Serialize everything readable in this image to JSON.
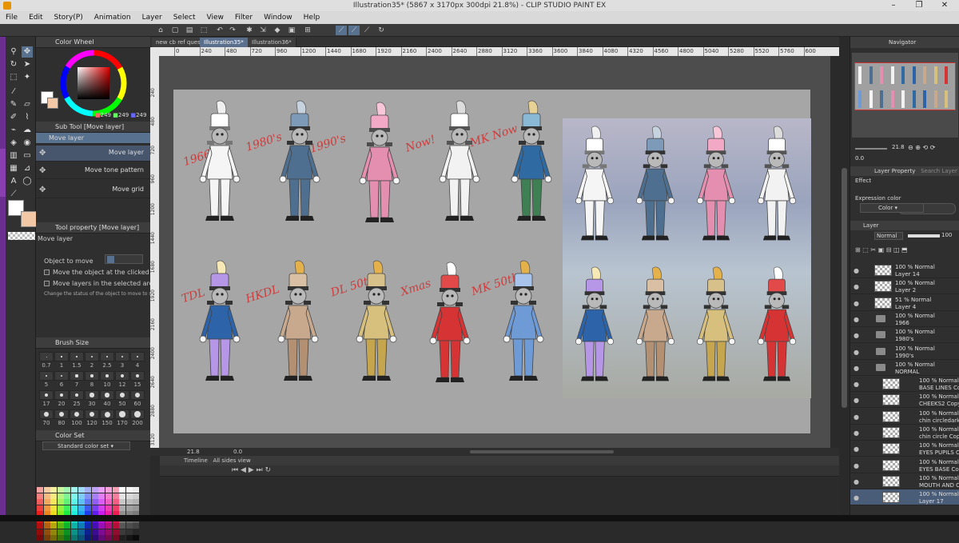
{
  "title_bar": {
    "text": "Illustration35* (5867 x 3170px 300dpi 21.8%) - CLIP STUDIO PAINT EX"
  },
  "menu": [
    "File",
    "Edit",
    "Story(P)",
    "Animation",
    "Layer",
    "Select",
    "View",
    "Filter",
    "Window",
    "Help"
  ],
  "window_controls": [
    "–",
    "❐",
    "✕"
  ],
  "left_panel": {
    "color_wheel_title": "Color Wheel",
    "color_values": {
      "r": "249",
      "g": "249",
      "b": "249"
    },
    "subtool_title": "Sub Tool [Move layer]",
    "subtool_group": "Move layer",
    "subtools": [
      "Move layer",
      "Move tone pattern",
      "Move grid"
    ],
    "tool_property_title": "Tool property [Move layer]",
    "tool_property_name": "Move layer",
    "object_to_move": "Object to move",
    "options": [
      "Move the object at the clicked position",
      "Move layers in the selected area",
      "Change the status of the object to move to selec"
    ],
    "brush_size_title": "Brush Size",
    "brush_sizes": [
      "0.7",
      "1",
      "1.5",
      "2",
      "2.5",
      "3",
      "4",
      "5",
      "6",
      "7",
      "8",
      "10",
      "12",
      "15",
      "17",
      "20",
      "25",
      "30",
      "40",
      "50",
      "60",
      "70",
      "80",
      "100",
      "120",
      "150",
      "170",
      "200"
    ],
    "color_set_title": "Color Set",
    "color_set_name": "Standard color set"
  },
  "tabs": [
    "new cb ref ques",
    "Illustration35*",
    "Illustration36*"
  ],
  "ruler_top_labels": [
    "0",
    "240",
    "480",
    "720",
    "960",
    "1200",
    "1440",
    "1680",
    "1920",
    "2160",
    "2400",
    "2640",
    "2880",
    "3120",
    "3360",
    "3600",
    "3840",
    "4080",
    "4320",
    "4560",
    "4800",
    "5040",
    "5280",
    "5520",
    "5760",
    "600"
  ],
  "ruler_left_labels": [
    "240",
    "480",
    "720",
    "960",
    "1200",
    "1440",
    "1680",
    "1920",
    "2160",
    "2400",
    "2640",
    "2880",
    "3120"
  ],
  "annotations": [
    "1966",
    "1980's",
    "1990's",
    "Now!",
    "MK Now",
    "TDL",
    "HKDL",
    "DL 50th",
    "Xmas",
    "MK 50th"
  ],
  "status": {
    "zoom": "21.8",
    "rotation": "0.0"
  },
  "timeline": {
    "title": "Timeline",
    "subtitle": "All sides view"
  },
  "navigator": {
    "title": "Navigator",
    "zoom": "21.8",
    "angle": "0.0"
  },
  "layer_property": {
    "title": "Layer Property",
    "search": "Search Layer",
    "effect": "Effect",
    "expression_color": "Expression color",
    "color_mode": "Color"
  },
  "layer_panel": {
    "title": "Layer",
    "blend_mode": "Normal",
    "opacity": "100",
    "layers": [
      {
        "pct": "100 % Normal",
        "name": "Layer 14",
        "kind": "layer"
      },
      {
        "pct": "100 % Normal",
        "name": "Layer 2",
        "kind": "layer"
      },
      {
        "pct": "51 % Normal",
        "name": "Layer 4",
        "kind": "layer"
      },
      {
        "pct": "100 % Normal",
        "name": "1966",
        "kind": "folder"
      },
      {
        "pct": "100 % Normal",
        "name": "1980's",
        "kind": "folder"
      },
      {
        "pct": "100 % Normal",
        "name": "1990's",
        "kind": "folder"
      },
      {
        "pct": "100 % Normal",
        "name": "NORMAL",
        "kind": "folder"
      },
      {
        "pct": "100 % Normal",
        "name": "BASE LINES Co",
        "kind": "layer"
      },
      {
        "pct": "100 % Normal",
        "name": "CHEEKS2 Copy 2",
        "kind": "layer"
      },
      {
        "pct": "100 % Normal",
        "name": "chin circledark C",
        "kind": "layer"
      },
      {
        "pct": "100 % Normal",
        "name": "chin circle Copy 2",
        "kind": "layer"
      },
      {
        "pct": "100 % Normal",
        "name": "EYES PUPILS C",
        "kind": "layer"
      },
      {
        "pct": "100 % Normal",
        "name": "EYES BASE Cop",
        "kind": "layer"
      },
      {
        "pct": "100 % Normal",
        "name": "MOUTH AND C",
        "kind": "layer"
      },
      {
        "pct": "100 % Normal",
        "name": "Layer 17",
        "kind": "layer"
      }
    ]
  },
  "colors": {
    "accent": "#57718f",
    "selected_layer": "#4a5d78",
    "artboard": "#a6a6a6",
    "annotation": "#cf3b3b"
  },
  "figures": [
    {
      "coat": "#f5f5f5",
      "pants": "#f5f5f5",
      "hat": "#ffffff",
      "plume": "#f0f0f0",
      "trim": "#777"
    },
    {
      "coat": "#4e6f8f",
      "pants": "#4e6f8f",
      "hat": "#7d9ab8",
      "plume": "#c7d2df",
      "trim": "#333"
    },
    {
      "coat": "#e58fb0",
      "pants": "#e58fb0",
      "hat": "#f2a9c5",
      "plume": "#f7c6d8",
      "trim": "#4d4d4d"
    },
    {
      "coat": "#f2f2f2",
      "pants": "#f2f2f2",
      "hat": "#ffffff",
      "plume": "#dcdcdc",
      "trim": "#555"
    },
    {
      "coat": "#2f6aa3",
      "pants": "#3f7f54",
      "hat": "#8ab9d6",
      "plume": "#e7d195",
      "trim": "#333"
    },
    {
      "coat": "#2d63a8",
      "pants": "#b696e6",
      "hat": "#b696e6",
      "plume": "#f6e9b5",
      "trim": "#333"
    },
    {
      "coat": "#c9a98d",
      "pants": "#b49072",
      "hat": "#d9c0a4",
      "plume": "#e5b14a",
      "trim": "#333"
    },
    {
      "coat": "#d7bf7d",
      "pants": "#c5a64f",
      "hat": "#d7c08a",
      "plume": "#e5b14a",
      "trim": "#333"
    },
    {
      "coat": "#d63434",
      "pants": "#d63434",
      "hat": "#e24a4a",
      "plume": "#ffffff",
      "trim": "#333"
    },
    {
      "coat": "#6e9ad6",
      "pants": "#6e9ad6",
      "hat": "#a9c4ea",
      "plume": "#e5b14a",
      "trim": "#333"
    }
  ]
}
